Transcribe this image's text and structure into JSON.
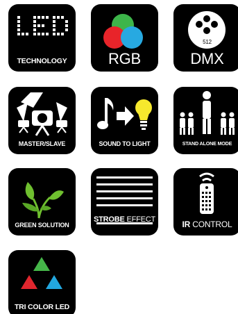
{
  "icons": [
    {
      "id": "led",
      "label": "TECHNOLOGY",
      "headline": "LED"
    },
    {
      "id": "rgb",
      "label": "RGB"
    },
    {
      "id": "dmx",
      "label": "DMX",
      "badge": "512"
    },
    {
      "id": "master-slave",
      "label": "MASTER/SLAVE"
    },
    {
      "id": "sound",
      "label": "SOUND TO LIGHT"
    },
    {
      "id": "stand-alone",
      "label": "STAND ALONE MODE"
    },
    {
      "id": "green",
      "label": "GREEN SOLUTION"
    },
    {
      "id": "strobe",
      "label_bold": "STROBE",
      "label_regular": "EFFECT"
    },
    {
      "id": "ir",
      "label_bold": "IR",
      "label_regular": "CONTROL"
    },
    {
      "id": "tri",
      "label": "TRI COLOR LED"
    }
  ],
  "colors": {
    "tile_bg": "#000000",
    "text": "#ffffff",
    "rgb_red": "#e8242a",
    "rgb_green": "#3db54a",
    "rgb_blue": "#27a9e1",
    "tri_green": "#45b649",
    "tri_red": "#e0262e",
    "tri_blue": "#22a7df",
    "bulb_yellow": "#f6e82d",
    "leaf_green": "#6fbf2f"
  }
}
